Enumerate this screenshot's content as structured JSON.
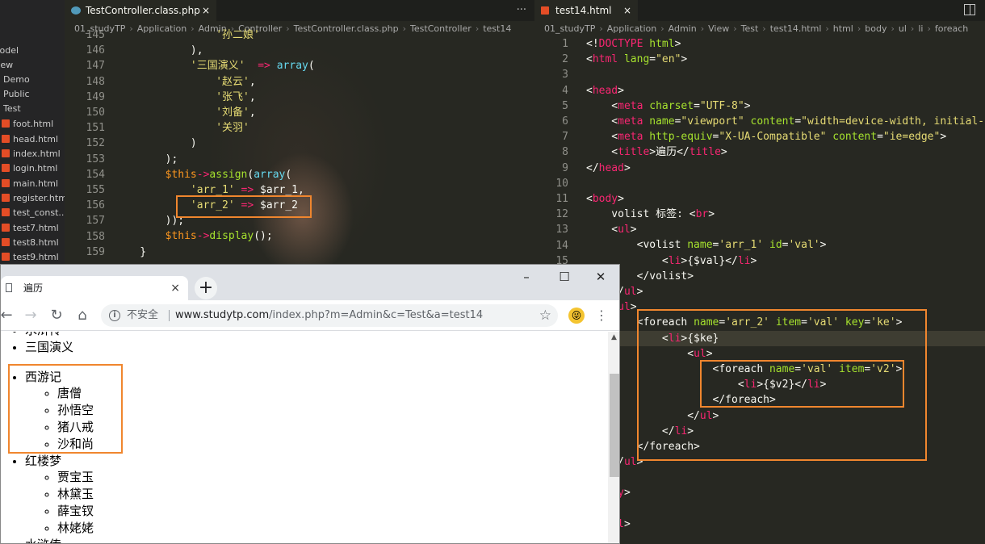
{
  "explorer": {
    "items": [
      {
        "label": "Model",
        "file": false
      },
      {
        "label": "View",
        "file": false
      },
      {
        "label": "Demo",
        "file": false
      },
      {
        "label": "Public",
        "file": false
      },
      {
        "label": "Test",
        "file": false
      },
      {
        "label": "foot.html",
        "file": true
      },
      {
        "label": "head.html",
        "file": true
      },
      {
        "label": "index.html",
        "file": true
      },
      {
        "label": "login.html",
        "file": true
      },
      {
        "label": "main.html",
        "file": true
      },
      {
        "label": "register.html",
        "file": true
      },
      {
        "label": "test_const...",
        "file": true
      },
      {
        "label": "test7.html",
        "file": true
      },
      {
        "label": "test8.html",
        "file": true
      },
      {
        "label": "test9.html",
        "file": true
      }
    ]
  },
  "left_editor": {
    "tab": "TestController.class.php",
    "tab_close": "×",
    "more": "···",
    "breadcrumb": [
      "01_studyTP",
      "Application",
      "Admin",
      "Controller",
      "TestController.class.php",
      "TestController",
      "test14"
    ],
    "lines": [
      {
        "n": "145",
        "t": [
          [
            "                '孙二娘'",
            "s"
          ]
        ]
      },
      {
        "n": "146",
        "t": [
          [
            "            ),",
            "w"
          ]
        ]
      },
      {
        "n": "147",
        "t": [
          [
            "            '三国演义'",
            "s"
          ],
          [
            "  => ",
            "k"
          ],
          [
            "array",
            "c"
          ],
          [
            "(",
            "w"
          ]
        ]
      },
      {
        "n": "148",
        "t": [
          [
            "                '赵云'",
            "s"
          ],
          [
            ",",
            "w"
          ]
        ]
      },
      {
        "n": "149",
        "t": [
          [
            "                '张飞'",
            "s"
          ],
          [
            ",",
            "w"
          ]
        ]
      },
      {
        "n": "150",
        "t": [
          [
            "                '刘备'",
            "s"
          ],
          [
            ",",
            "w"
          ]
        ]
      },
      {
        "n": "151",
        "t": [
          [
            "                '关羽'",
            "s"
          ]
        ]
      },
      {
        "n": "152",
        "t": [
          [
            "            )",
            "w"
          ]
        ]
      },
      {
        "n": "153",
        "t": [
          [
            "        );",
            "w"
          ]
        ]
      },
      {
        "n": "154",
        "t": [
          [
            "        ",
            "w"
          ],
          [
            "$this",
            "v"
          ],
          [
            "->",
            "k"
          ],
          [
            "assign",
            "f"
          ],
          [
            "(",
            "w"
          ],
          [
            "array",
            "c"
          ],
          [
            "(",
            "w"
          ]
        ]
      },
      {
        "n": "155",
        "t": [
          [
            "            'arr_1'",
            "s"
          ],
          [
            " => ",
            "k"
          ],
          [
            "$arr_1,",
            "w"
          ]
        ]
      },
      {
        "n": "156",
        "t": [
          [
            "            'arr_2'",
            "s"
          ],
          [
            " => ",
            "k"
          ],
          [
            "$arr_2",
            "w"
          ]
        ]
      },
      {
        "n": "157",
        "t": [
          [
            "        ));",
            "w"
          ]
        ]
      },
      {
        "n": "158",
        "t": [
          [
            "        ",
            "w"
          ],
          [
            "$this",
            "v"
          ],
          [
            "->",
            "k"
          ],
          [
            "display",
            "f"
          ],
          [
            "();",
            "w"
          ]
        ]
      },
      {
        "n": "159",
        "t": [
          [
            "    }",
            "w"
          ]
        ]
      }
    ]
  },
  "right_editor": {
    "tab": "test14.html",
    "tab_close": "×",
    "breadcrumb": [
      "01_studyTP",
      "Application",
      "Admin",
      "View",
      "Test",
      "test14.html",
      "html",
      "body",
      "ul",
      "li",
      "foreach"
    ],
    "lines": [
      {
        "n": "1",
        "t": [
          [
            "<!",
            "w"
          ],
          [
            "DOCTYPE",
            "k"
          ],
          [
            " html",
            "f"
          ],
          [
            ">",
            "w"
          ]
        ]
      },
      {
        "n": "2",
        "t": [
          [
            "<",
            "w"
          ],
          [
            "html",
            "k"
          ],
          [
            " lang",
            "f"
          ],
          [
            "=",
            "w"
          ],
          [
            "\"en\"",
            "s"
          ],
          [
            ">",
            "w"
          ]
        ]
      },
      {
        "n": "3",
        "t": []
      },
      {
        "n": "4",
        "t": [
          [
            "<",
            "w"
          ],
          [
            "head",
            "k"
          ],
          [
            ">",
            "w"
          ]
        ]
      },
      {
        "n": "5",
        "t": [
          [
            "    <",
            "w"
          ],
          [
            "meta",
            "k"
          ],
          [
            " charset",
            "f"
          ],
          [
            "=",
            "w"
          ],
          [
            "\"UTF-8\"",
            "s"
          ],
          [
            ">",
            "w"
          ]
        ]
      },
      {
        "n": "6",
        "t": [
          [
            "    <",
            "w"
          ],
          [
            "meta",
            "k"
          ],
          [
            " name",
            "f"
          ],
          [
            "=",
            "w"
          ],
          [
            "\"viewport\"",
            "s"
          ],
          [
            " content",
            "f"
          ],
          [
            "=",
            "w"
          ],
          [
            "\"width=device-width, initial-sc",
            "s"
          ]
        ]
      },
      {
        "n": "7",
        "t": [
          [
            "    <",
            "w"
          ],
          [
            "meta",
            "k"
          ],
          [
            " http-equiv",
            "f"
          ],
          [
            "=",
            "w"
          ],
          [
            "\"X-UA-Compatible\"",
            "s"
          ],
          [
            " content",
            "f"
          ],
          [
            "=",
            "w"
          ],
          [
            "\"ie=edge\"",
            "s"
          ],
          [
            ">",
            "w"
          ]
        ]
      },
      {
        "n": "8",
        "t": [
          [
            "    <",
            "w"
          ],
          [
            "title",
            "k"
          ],
          [
            ">遍历</",
            "w"
          ],
          [
            "title",
            "k"
          ],
          [
            ">",
            "w"
          ]
        ]
      },
      {
        "n": "9",
        "t": [
          [
            "</",
            "w"
          ],
          [
            "head",
            "k"
          ],
          [
            ">",
            "w"
          ]
        ]
      },
      {
        "n": "10",
        "t": []
      },
      {
        "n": "11",
        "t": [
          [
            "<",
            "w"
          ],
          [
            "body",
            "k"
          ],
          [
            ">",
            "w"
          ]
        ]
      },
      {
        "n": "12",
        "t": [
          [
            "    volist 标签: <",
            "w"
          ],
          [
            "br",
            "k"
          ],
          [
            ">",
            "w"
          ]
        ]
      },
      {
        "n": "13",
        "t": [
          [
            "    <",
            "w"
          ],
          [
            "ul",
            "k"
          ],
          [
            ">",
            "w"
          ]
        ]
      },
      {
        "n": "14",
        "t": [
          [
            "        <volist ",
            "w"
          ],
          [
            "name",
            "f"
          ],
          [
            "=",
            "w"
          ],
          [
            "'arr_1'",
            "s"
          ],
          [
            " id",
            "f"
          ],
          [
            "=",
            "w"
          ],
          [
            "'val'",
            "s"
          ],
          [
            ">",
            "w"
          ]
        ]
      },
      {
        "n": "15",
        "t": [
          [
            "            <",
            "w"
          ],
          [
            "li",
            "k"
          ],
          [
            ">{$val}</",
            "w"
          ],
          [
            "li",
            "k"
          ],
          [
            ">",
            "w"
          ]
        ]
      },
      {
        "n": "16",
        "t": [
          [
            "        </volist>",
            "w"
          ]
        ]
      },
      {
        "n": "17",
        "t": [
          [
            "    </",
            "w"
          ],
          [
            "ul",
            "k"
          ],
          [
            ">",
            "w"
          ]
        ]
      },
      {
        "n": "18",
        "t": [
          [
            "    <",
            "w"
          ],
          [
            "ul",
            "k"
          ],
          [
            ">",
            "w"
          ]
        ]
      },
      {
        "n": "19",
        "t": [
          [
            "        <foreach ",
            "w"
          ],
          [
            "name",
            "f"
          ],
          [
            "=",
            "w"
          ],
          [
            "'arr_2'",
            "s"
          ],
          [
            " item",
            "f"
          ],
          [
            "=",
            "w"
          ],
          [
            "'val'",
            "s"
          ],
          [
            " key",
            "f"
          ],
          [
            "=",
            "w"
          ],
          [
            "'ke'",
            "s"
          ],
          [
            ">",
            "w"
          ]
        ]
      },
      {
        "n": "20",
        "t": [
          [
            "            <",
            "w"
          ],
          [
            "li",
            "k"
          ],
          [
            ">{$ke}",
            "w"
          ]
        ]
      },
      {
        "n": "21",
        "t": [
          [
            "                <",
            "w"
          ],
          [
            "ul",
            "k"
          ],
          [
            ">",
            "w"
          ]
        ]
      },
      {
        "n": "22",
        "t": [
          [
            "                    <foreach ",
            "w"
          ],
          [
            "name",
            "f"
          ],
          [
            "=",
            "w"
          ],
          [
            "'val'",
            "s"
          ],
          [
            " item",
            "f"
          ],
          [
            "=",
            "w"
          ],
          [
            "'v2'",
            "s"
          ],
          [
            ">",
            "w"
          ]
        ]
      },
      {
        "n": "23",
        "t": [
          [
            "                        <",
            "w"
          ],
          [
            "li",
            "k"
          ],
          [
            ">{$v2}</",
            "w"
          ],
          [
            "li",
            "k"
          ],
          [
            ">",
            "w"
          ]
        ]
      },
      {
        "n": "24",
        "t": [
          [
            "                    </foreach>",
            "w"
          ]
        ]
      },
      {
        "n": "25",
        "t": [
          [
            "                </",
            "w"
          ],
          [
            "ul",
            "k"
          ],
          [
            ">",
            "w"
          ]
        ]
      },
      {
        "n": "26",
        "t": [
          [
            "            </",
            "w"
          ],
          [
            "li",
            "k"
          ],
          [
            ">",
            "w"
          ]
        ]
      },
      {
        "n": "27",
        "t": [
          [
            "        </foreach>",
            "w"
          ]
        ]
      },
      {
        "n": "28",
        "t": [
          [
            "    </",
            "w"
          ],
          [
            "ul",
            "k"
          ],
          [
            ">",
            "w"
          ]
        ]
      },
      {
        "n": "29",
        "t": []
      },
      {
        "n": "30",
        "t": [
          [
            "</",
            "w"
          ],
          [
            "body",
            "k"
          ],
          [
            ">",
            "w"
          ]
        ]
      },
      {
        "n": "31",
        "t": []
      },
      {
        "n": "32",
        "t": [
          [
            "</",
            "w"
          ],
          [
            "html",
            "k"
          ],
          [
            ">",
            "w"
          ]
        ]
      }
    ]
  },
  "browser": {
    "tab_title": "遍历",
    "tab_close": "×",
    "new_tab": "+",
    "minimize": "–",
    "maximize": "☐",
    "close": "✕",
    "back": "←",
    "forward": "→",
    "reload": "↻",
    "home": "⌂",
    "info": "i",
    "insecure": "不安全",
    "url_host": "www.studytp.com",
    "url_path": "/index.php?m=Admin&c=Test&a=test14",
    "star": "☆",
    "avatar": "😜",
    "menu": "⋮",
    "scroll_up": "▲",
    "list": [
      {
        "label": "水浒传",
        "children": []
      },
      {
        "label": "三国演义",
        "children": []
      },
      {
        "label": "西游记",
        "children": [
          "唐僧",
          "孙悟空",
          "猪八戒",
          "沙和尚"
        ]
      },
      {
        "label": "红楼梦",
        "children": [
          "贾宝玉",
          "林黛玉",
          "薛宝钗",
          "林姥姥"
        ]
      },
      {
        "label": "水浒传",
        "children": []
      }
    ]
  }
}
